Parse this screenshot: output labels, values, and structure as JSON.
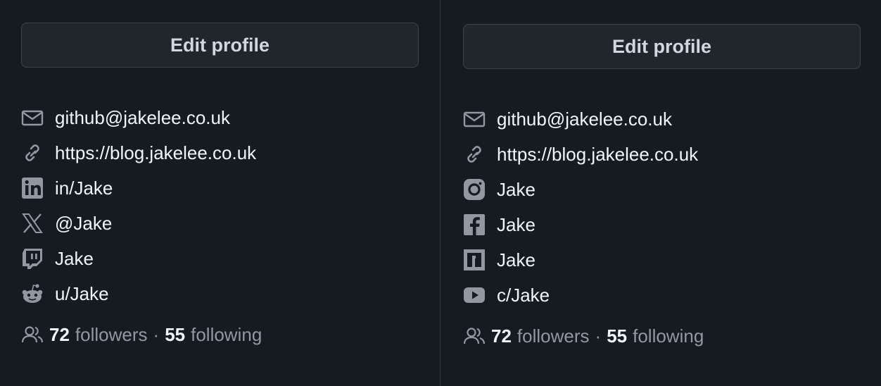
{
  "left": {
    "edit_button": "Edit profile",
    "links": [
      {
        "icon": "mail-icon",
        "text": "github@jakelee.co.uk"
      },
      {
        "icon": "link-icon",
        "text": "https://blog.jakelee.co.uk"
      },
      {
        "icon": "linkedin-icon",
        "text": "in/Jake"
      },
      {
        "icon": "x-icon",
        "text": "@Jake"
      },
      {
        "icon": "twitch-icon",
        "text": "Jake"
      },
      {
        "icon": "reddit-icon",
        "text": "u/Jake"
      }
    ],
    "followers_count": "72",
    "followers_label": "followers",
    "separator": "·",
    "following_count": "55",
    "following_label": "following"
  },
  "right": {
    "edit_button": "Edit profile",
    "links": [
      {
        "icon": "mail-icon",
        "text": "github@jakelee.co.uk"
      },
      {
        "icon": "link-icon",
        "text": "https://blog.jakelee.co.uk"
      },
      {
        "icon": "instagram-icon",
        "text": "Jake"
      },
      {
        "icon": "facebook-icon",
        "text": "Jake"
      },
      {
        "icon": "npm-icon",
        "text": "Jake"
      },
      {
        "icon": "youtube-icon",
        "text": "c/Jake"
      }
    ],
    "followers_count": "72",
    "followers_label": "followers",
    "separator": "·",
    "following_count": "55",
    "following_label": "following"
  },
  "colors": {
    "background": "#161b22",
    "text": "#f0f6fc",
    "muted": "#9198a1",
    "button_bg": "#21262d",
    "border": "#3d444d"
  }
}
